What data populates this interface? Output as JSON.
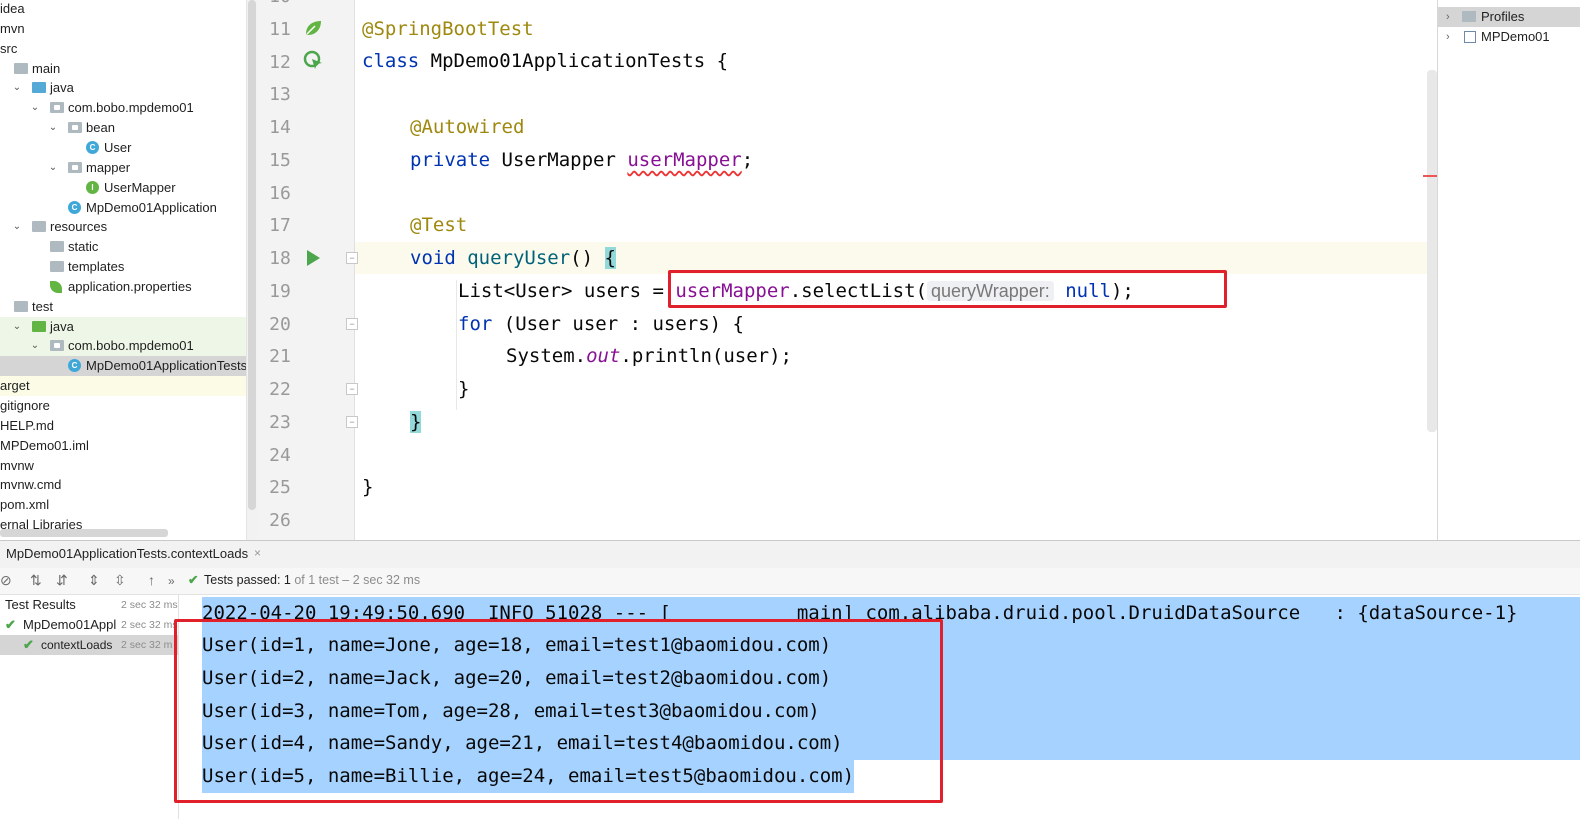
{
  "project_tree": [
    {
      "label": "idea",
      "indent": -1,
      "arrow": "",
      "icon": "none"
    },
    {
      "label": "mvn",
      "indent": -1,
      "arrow": "",
      "icon": "none"
    },
    {
      "label": "src",
      "indent": -1,
      "arrow": "",
      "icon": "none"
    },
    {
      "label": "main",
      "indent": 0,
      "arrow": "",
      "icon": "folder-gray"
    },
    {
      "label": "java",
      "indent": 1,
      "arrow": "v",
      "icon": "folder-blue"
    },
    {
      "label": "com.bobo.mpdemo01",
      "indent": 2,
      "arrow": "v",
      "icon": "package"
    },
    {
      "label": "bean",
      "indent": 3,
      "arrow": "v",
      "icon": "package"
    },
    {
      "label": "User",
      "indent": 4,
      "arrow": "",
      "icon": "class"
    },
    {
      "label": "mapper",
      "indent": 3,
      "arrow": "v",
      "icon": "package"
    },
    {
      "label": "UserMapper",
      "indent": 4,
      "arrow": "",
      "icon": "interface"
    },
    {
      "label": "MpDemo01Application",
      "indent": 3,
      "arrow": "",
      "icon": "spring-class"
    },
    {
      "label": "resources",
      "indent": 1,
      "arrow": "v",
      "icon": "folder-resources"
    },
    {
      "label": "static",
      "indent": 2,
      "arrow": "",
      "icon": "folder-gray"
    },
    {
      "label": "templates",
      "indent": 2,
      "arrow": "",
      "icon": "folder-gray"
    },
    {
      "label": "application.properties",
      "indent": 2,
      "arrow": "",
      "icon": "leaf"
    },
    {
      "label": "test",
      "indent": 0,
      "arrow": "",
      "icon": "folder-gray"
    },
    {
      "label": "java",
      "indent": 1,
      "arrow": "v",
      "icon": "folder-green"
    },
    {
      "label": "com.bobo.mpdemo01",
      "indent": 2,
      "arrow": "v",
      "icon": "package"
    },
    {
      "label": "MpDemo01ApplicationTests",
      "indent": 3,
      "arrow": "",
      "icon": "test-class"
    },
    {
      "label": "arget",
      "indent": -1,
      "arrow": "",
      "icon": "none"
    },
    {
      "label": "gitignore",
      "indent": -1,
      "arrow": "",
      "icon": "none"
    },
    {
      "label": "HELP.md",
      "indent": -1,
      "arrow": "",
      "icon": "none"
    },
    {
      "label": "MPDemo01.iml",
      "indent": -1,
      "arrow": "",
      "icon": "none"
    },
    {
      "label": "mvnw",
      "indent": -1,
      "arrow": "",
      "icon": "none"
    },
    {
      "label": "mvnw.cmd",
      "indent": -1,
      "arrow": "",
      "icon": "none"
    },
    {
      "label": "pom.xml",
      "indent": -1,
      "arrow": "",
      "icon": "none"
    },
    {
      "label": "ernal Libraries",
      "indent": -1,
      "arrow": "",
      "icon": "none"
    }
  ],
  "line_numbers": [
    "10",
    "11",
    "12",
    "13",
    "14",
    "15",
    "16",
    "17",
    "18",
    "19",
    "20",
    "21",
    "22",
    "23",
    "24",
    "25",
    "26"
  ],
  "code": {
    "l11": "@SpringBootTest",
    "l12_kw": "class",
    "l12_rest": " MpDemo01ApplicationTests {",
    "l14": "@Autowired",
    "l15_kw": "private",
    "l15_type": " UserMapper ",
    "l15_field": "userMapper",
    "l15_end": ";",
    "l17": "@Test",
    "l18_kw": "void",
    "l18_sp": " ",
    "l18_method": "queryUser",
    "l18_paren": "() ",
    "l18_brace": "{",
    "l19_pre": "List<User> users = ",
    "l19_field": "userMapper",
    "l19_call": ".selectList(",
    "l19_hint": "queryWrapper:",
    "l19_null": "null",
    "l19_end": ");",
    "l20_kw": "for",
    "l20_rest": " (User user : users) {",
    "l21_pre": "System.",
    "l21_out": "out",
    "l21_rest": ".println(user);",
    "l22": "}",
    "l23": "}",
    "l25": "}"
  },
  "maven_panel": {
    "items": [
      "Profiles",
      "MPDemo01"
    ]
  },
  "run_panel": {
    "tab_title": "MpDemo01ApplicationTests.contextLoads",
    "tab_close": "×",
    "status_prefix": "Tests passed: ",
    "status_count": "1",
    "status_suffix": " of 1 test – 2 sec 32 ms",
    "results": [
      {
        "label": "Test Results",
        "time": "2 sec 32 ms"
      },
      {
        "label": "MpDemo01Appl",
        "time": "2 sec 32 ms"
      },
      {
        "label": "contextLoads",
        "time": "2 sec 32 m"
      }
    ]
  },
  "console_lines": [
    "2022-04-20 19:49:50.690  INFO 51028 --- [           main] com.alibaba.druid.pool.DruidDataSource   : {dataSource-1}",
    "User(id=1, name=Jone, age=18, email=test1@baomidou.com)",
    "User(id=2, name=Jack, age=20, email=test2@baomidou.com)",
    "User(id=3, name=Tom, age=28, email=test3@baomidou.com)",
    "User(id=4, name=Sandy, age=21, email=test4@baomidou.com)",
    "User(id=5, name=Billie, age=24, email=test5@baomidou.com)"
  ],
  "colors": {
    "keyword": "#0033b3",
    "annotation": "#9e880d",
    "field": "#871094",
    "method": "#00627a",
    "selection": "#a6d2ff",
    "highlight_box": "#e0202a",
    "pass_green": "#4ca64c"
  }
}
